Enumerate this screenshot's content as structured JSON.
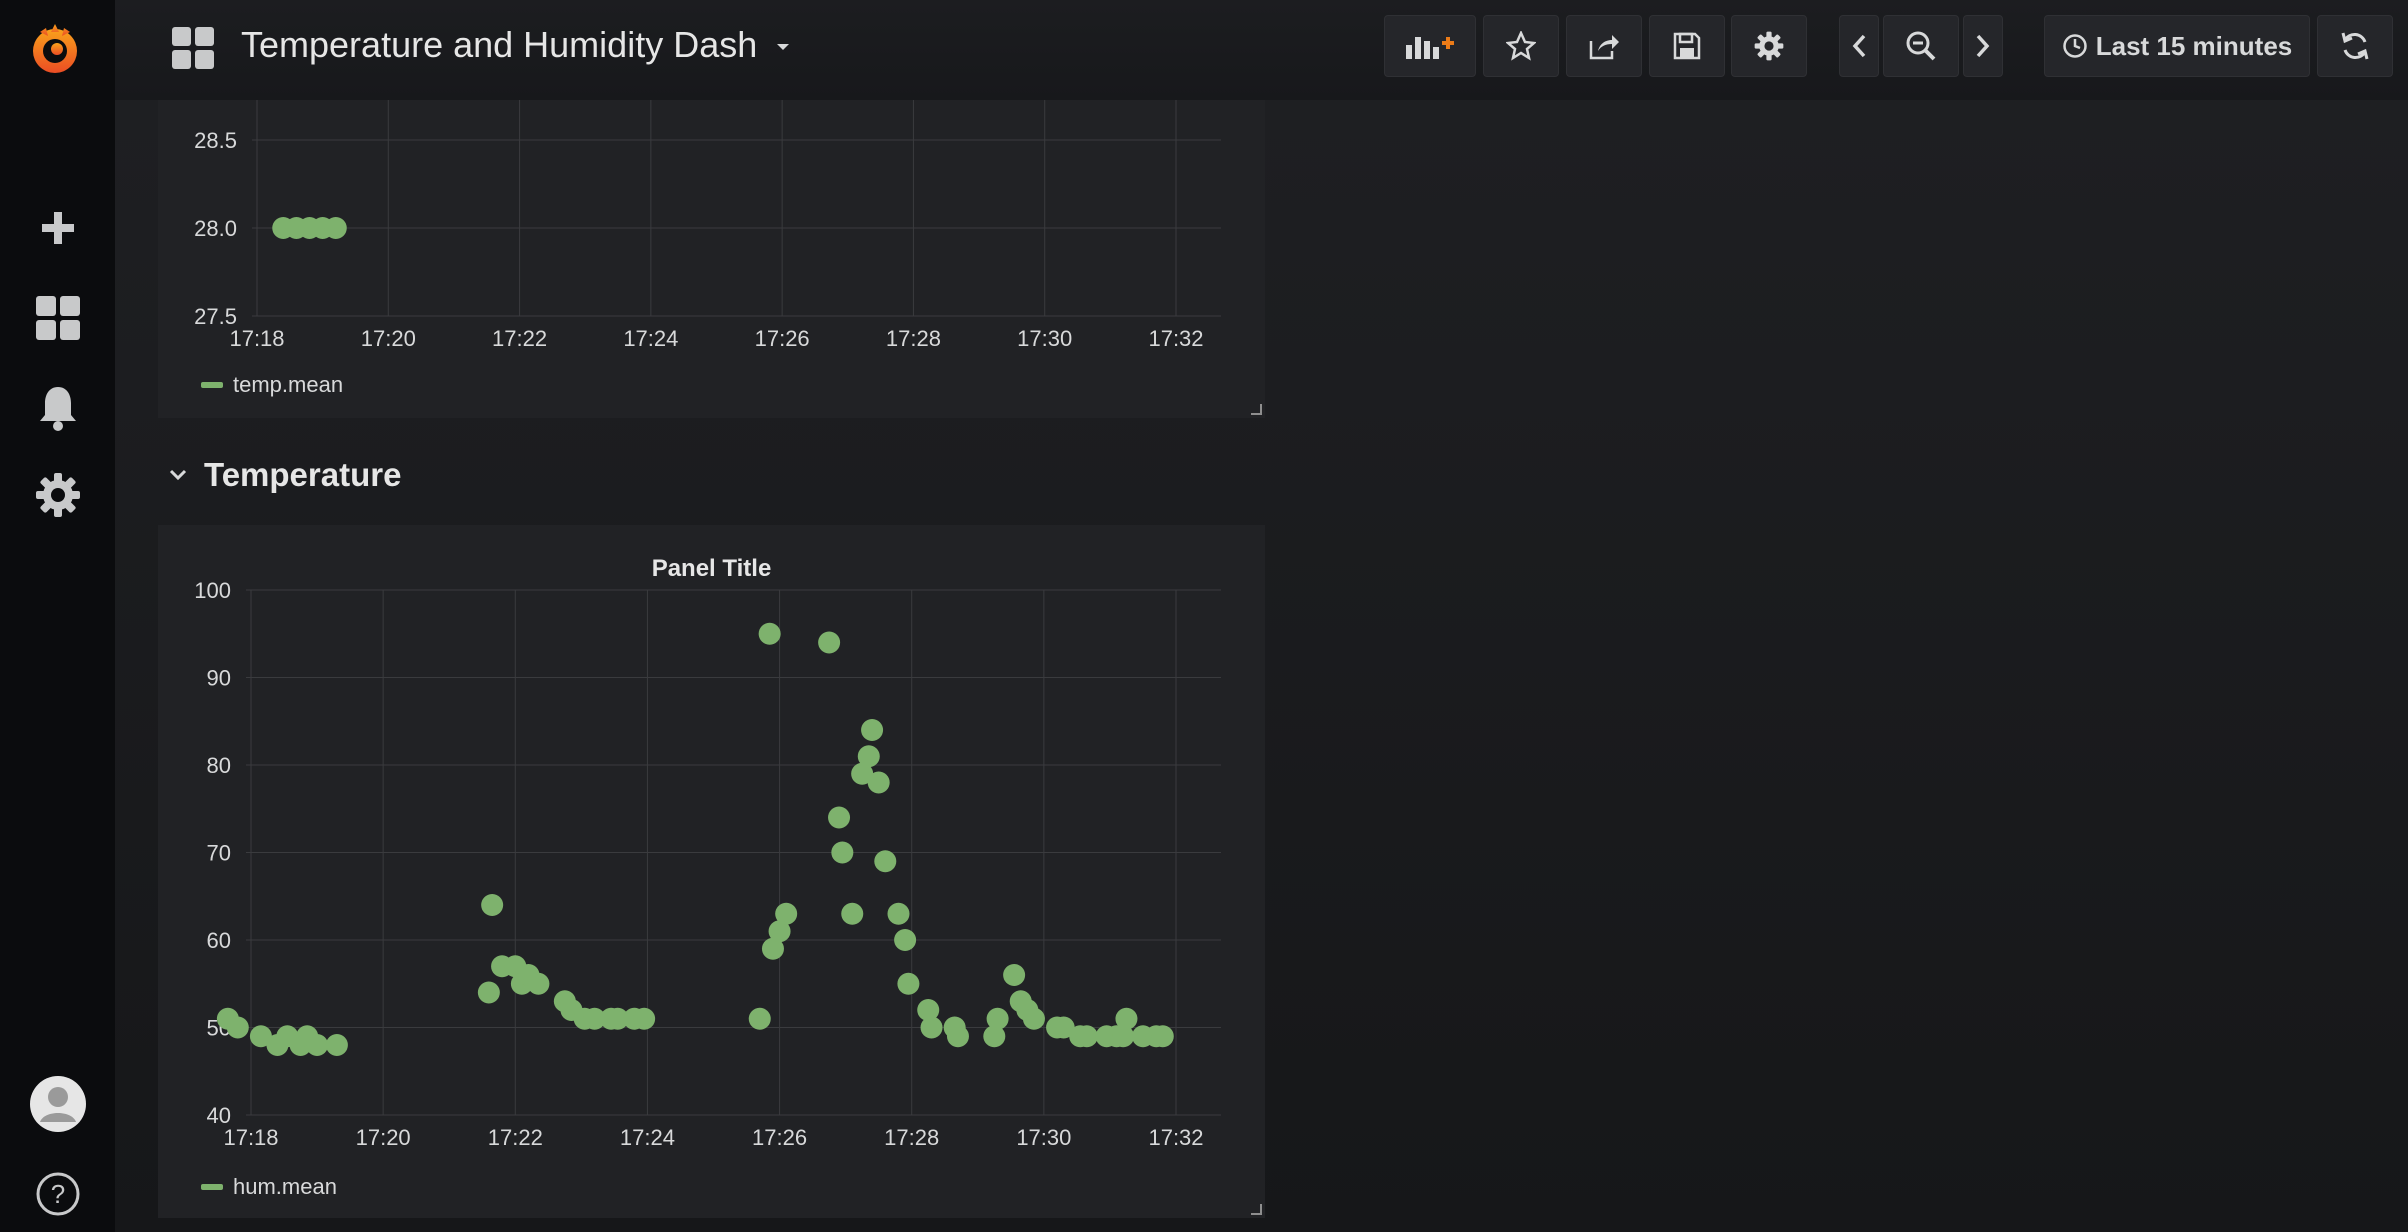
{
  "header": {
    "dashboard_title": "Temperature and Humidity Dash",
    "time_range": "Last 15 minutes"
  },
  "row": {
    "title": "Temperature"
  },
  "icons": [
    "grafana-logo-icon",
    "plus-icon",
    "dashboards-icon",
    "bell-icon",
    "gear-icon",
    "avatar",
    "help-icon",
    "add-panel-icon",
    "star-icon",
    "share-icon",
    "save-icon",
    "settings-icon",
    "chevron-left-icon",
    "zoom-out-icon",
    "chevron-right-icon",
    "clock-icon",
    "refresh-icon"
  ],
  "colors": {
    "accent": "#eb7b18",
    "series": "#7eb26d",
    "background": "#161719",
    "panel": "#212225"
  },
  "chart_data": [
    {
      "type": "scatter",
      "title": "",
      "ylim": [
        27.5,
        28.5
      ],
      "y_ticks": [
        "27.5",
        "28.0",
        "28.5"
      ],
      "x_ticks": [
        "17:18",
        "17:20",
        "17:22",
        "17:24",
        "17:26",
        "17:28",
        "17:30",
        "17:32"
      ],
      "series": [
        {
          "name": "temp.mean",
          "points": [
            [
              "17:18:24",
              28.0
            ],
            [
              "17:18:36",
              28.0
            ],
            [
              "17:18:48",
              28.0
            ],
            [
              "17:19:00",
              28.0
            ],
            [
              "17:19:12",
              28.0
            ]
          ]
        }
      ],
      "legend": "bottom-left"
    },
    {
      "type": "scatter",
      "title": "Panel Title",
      "ylim": [
        40,
        100
      ],
      "y_ticks": [
        "40",
        "50",
        "60",
        "70",
        "80",
        "90",
        "100"
      ],
      "x_ticks": [
        "17:18",
        "17:20",
        "17:22",
        "17:24",
        "17:26",
        "17:28",
        "17:30",
        "17:32"
      ],
      "series": [
        {
          "name": "hum.mean",
          "points": [
            [
              "17:17:39",
              51
            ],
            [
              "17:17:48",
              50
            ],
            [
              "17:18:09",
              49
            ],
            [
              "17:18:24",
              48
            ],
            [
              "17:18:33",
              49
            ],
            [
              "17:18:45",
              48
            ],
            [
              "17:18:51",
              49
            ],
            [
              "17:19:00",
              48
            ],
            [
              "17:19:18",
              48
            ],
            [
              "17:21:36",
              54
            ],
            [
              "17:21:39",
              64
            ],
            [
              "17:21:48",
              57
            ],
            [
              "17:22:00",
              57
            ],
            [
              "17:22:06",
              55
            ],
            [
              "17:22:12",
              56
            ],
            [
              "17:22:21",
              55
            ],
            [
              "17:22:45",
              53
            ],
            [
              "17:22:51",
              52
            ],
            [
              "17:23:03",
              51
            ],
            [
              "17:23:12",
              51
            ],
            [
              "17:23:27",
              51
            ],
            [
              "17:23:33",
              51
            ],
            [
              "17:23:48",
              51
            ],
            [
              "17:23:57",
              51
            ],
            [
              "17:25:42",
              51
            ],
            [
              "17:25:51",
              95
            ],
            [
              "17:25:54",
              59
            ],
            [
              "17:26:00",
              61
            ],
            [
              "17:26:06",
              63
            ],
            [
              "17:26:45",
              94
            ],
            [
              "17:26:54",
              74
            ],
            [
              "17:26:57",
              70
            ],
            [
              "17:27:06",
              63
            ],
            [
              "17:27:15",
              79
            ],
            [
              "17:27:21",
              81
            ],
            [
              "17:27:24",
              84
            ],
            [
              "17:27:30",
              78
            ],
            [
              "17:27:36",
              69
            ],
            [
              "17:27:48",
              63
            ],
            [
              "17:27:54",
              60
            ],
            [
              "17:27:57",
              55
            ],
            [
              "17:28:15",
              52
            ],
            [
              "17:28:18",
              50
            ],
            [
              "17:28:39",
              50
            ],
            [
              "17:28:42",
              49
            ],
            [
              "17:29:15",
              49
            ],
            [
              "17:29:18",
              51
            ],
            [
              "17:29:33",
              56
            ],
            [
              "17:29:39",
              53
            ],
            [
              "17:29:45",
              52
            ],
            [
              "17:29:51",
              51
            ],
            [
              "17:30:12",
              50
            ],
            [
              "17:30:18",
              50
            ],
            [
              "17:30:33",
              49
            ],
            [
              "17:30:39",
              49
            ],
            [
              "17:30:57",
              49
            ],
            [
              "17:31:06",
              49
            ],
            [
              "17:31:12",
              49
            ],
            [
              "17:31:15",
              51
            ],
            [
              "17:31:30",
              49
            ],
            [
              "17:31:42",
              49
            ],
            [
              "17:31:48",
              49
            ]
          ]
        }
      ],
      "legend": "bottom-left"
    }
  ]
}
